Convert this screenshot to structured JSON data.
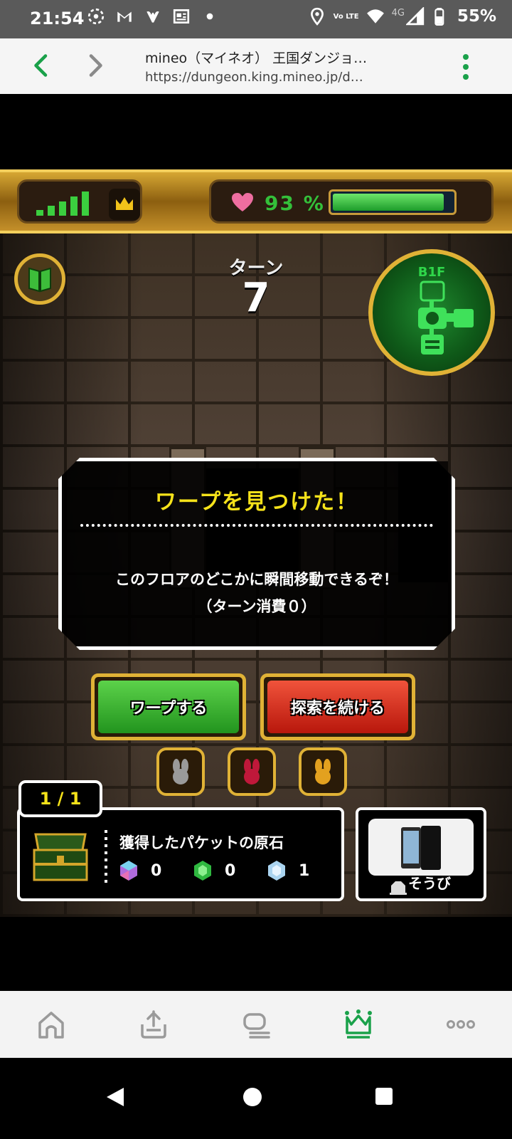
{
  "status_bar": {
    "time": "21:54",
    "network_type": "4G",
    "lte_label": "Vo LTE",
    "battery": "55%",
    "left_icons": [
      "spinner-icon",
      "gmail-icon",
      "messenger-icon",
      "news-icon",
      "dot-icon"
    ],
    "right_icons": [
      "location-icon",
      "volte-icon",
      "wifi-icon",
      "signal-icon",
      "battery-icon"
    ]
  },
  "browser": {
    "title": "mineo（マイネオ） 王国ダンジョ…",
    "url": "https://dungeon.king.mineo.jp/d…",
    "accent_color": "#1aa14a"
  },
  "hud": {
    "hp_percent_text": "93 %",
    "hp_fill": 0.93,
    "signal_bars": 5
  },
  "turn": {
    "label": "ターン",
    "number": "7"
  },
  "minimap": {
    "floor": "B1F"
  },
  "dialog": {
    "title": "ワープを見つけた！",
    "message": "このフロアのどこかに瞬間移動できるぞ！",
    "sub_message": "（ターン消費０）"
  },
  "buttons": {
    "warp": "ワープする",
    "continue": "探索を続ける"
  },
  "items": {
    "slot_colors": [
      "#9a9a9a",
      "#c0183a",
      "#e3a11f"
    ]
  },
  "inventory": {
    "count": "1 / 1",
    "title": "獲得したパケットの原石",
    "gems": [
      {
        "icon": "rainbow-gem-icon",
        "count": "0",
        "color": "#b06adc"
      },
      {
        "icon": "green-gem-icon",
        "count": "0",
        "color": "#2fb840"
      },
      {
        "icon": "blue-gem-icon",
        "count": "1",
        "color": "#aad4f0"
      }
    ]
  },
  "equip": {
    "label": "そうび"
  },
  "bottom_nav": {
    "items": [
      "home-icon",
      "download-icon",
      "tabs-icon",
      "crown-icon",
      "more-icon"
    ],
    "active_color": "#1aa14a"
  }
}
